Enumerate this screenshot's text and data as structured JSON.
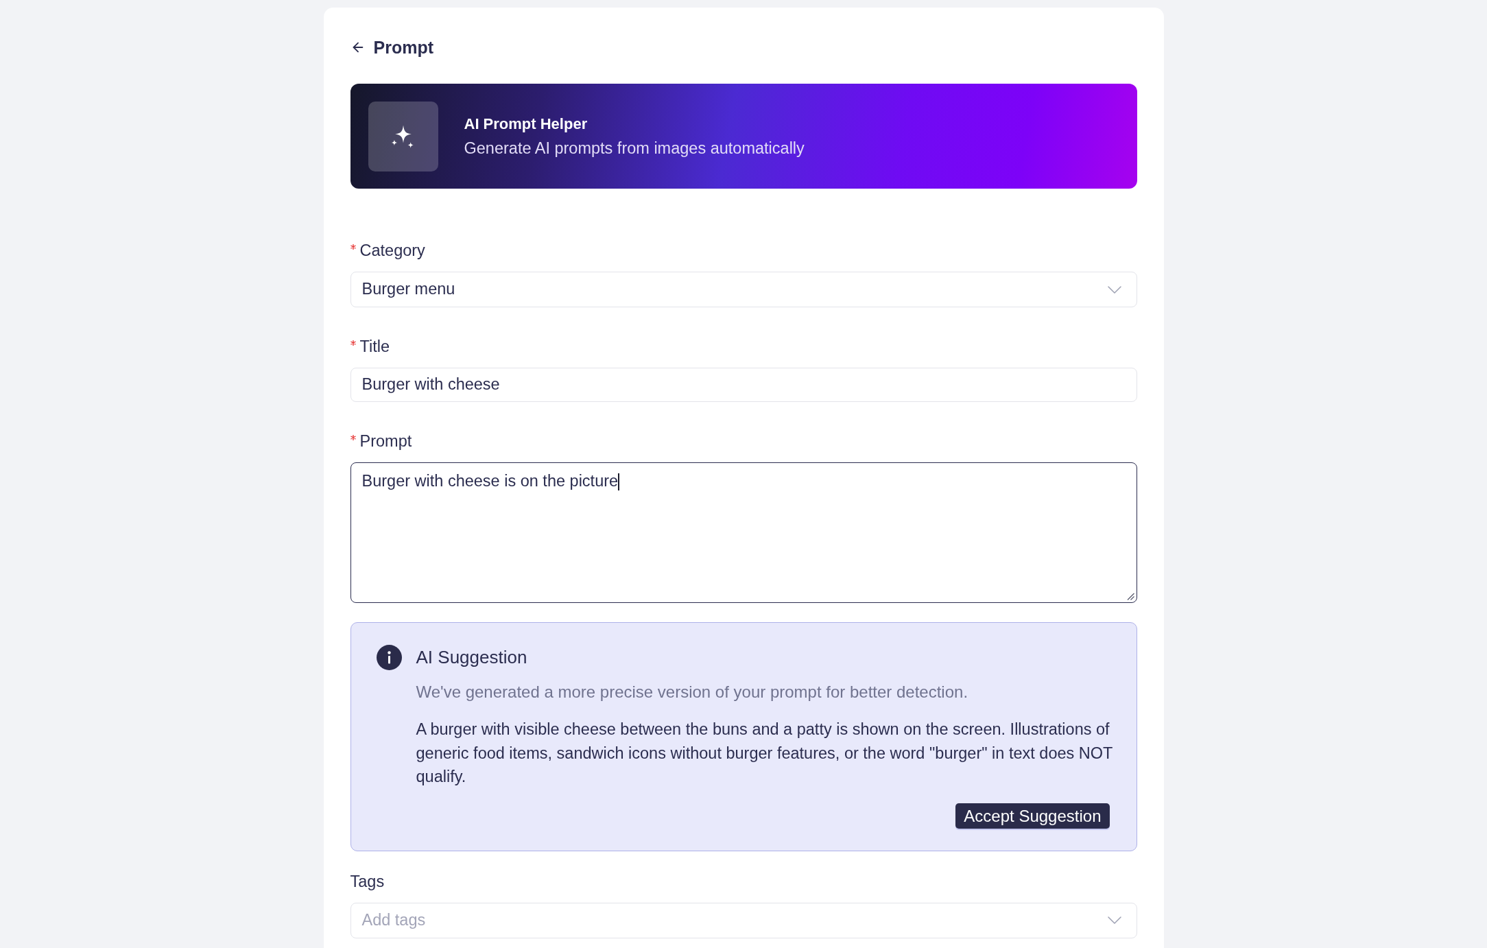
{
  "header": {
    "title": "Prompt"
  },
  "banner": {
    "title": "AI Prompt Helper",
    "subtitle": "Generate AI prompts from images automatically"
  },
  "fields": [
    {
      "kind": "select",
      "label": "Category",
      "required": true,
      "focused": false,
      "value": "Burger menu"
    },
    {
      "kind": "text",
      "label": "Title",
      "required": true,
      "focused": false,
      "value": "Burger with cheese"
    },
    {
      "kind": "textarea",
      "label": "Prompt",
      "required": true,
      "focused": true,
      "value": "Burger with cheese is on the picture"
    }
  ],
  "suggestion": {
    "title": "AI Suggestion",
    "description": "We've generated a more precise version of your prompt for better detection.",
    "text": "A burger with visible cheese between the buns and a patty is shown on the screen. Illustrations of generic food items, sandwich icons without burger features, or the word \"burger\" in text does NOT qualify.",
    "button": "Accept Suggestion"
  },
  "tags": {
    "kind": "select",
    "label": "Tags",
    "required": false,
    "focused": false,
    "placeholder": "Add tags"
  }
}
